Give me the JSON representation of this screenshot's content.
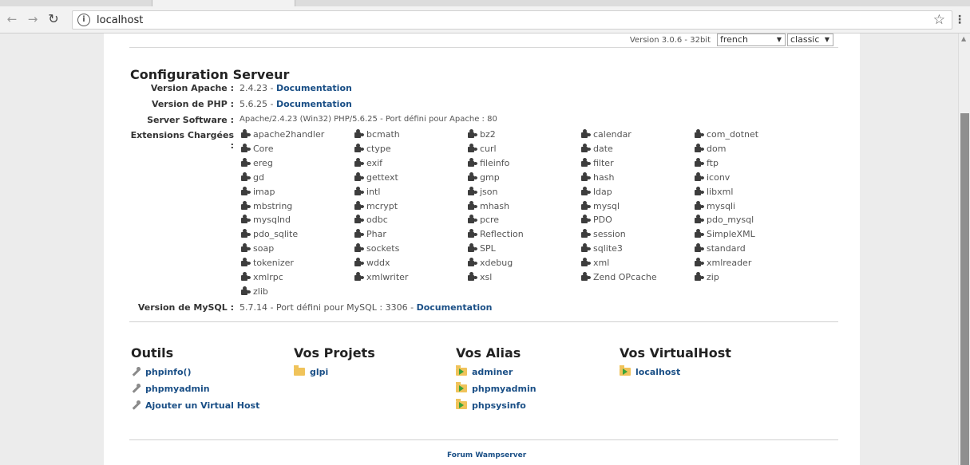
{
  "browser": {
    "url": "localhost",
    "back_icon": "back-arrow-icon",
    "forward_icon": "forward-arrow-icon",
    "reload_icon": "reload-icon"
  },
  "top": {
    "version": "Version 3.0.6 - 32bit",
    "language": "french",
    "style": "classic"
  },
  "config": {
    "title": "Configuration Serveur",
    "apache_label": "Version Apache :",
    "apache_value": "2.4.23 -",
    "apache_doc": "Documentation",
    "php_label": "Version de PHP :",
    "php_value": "5.6.25 -",
    "php_doc": "Documentation",
    "software_label": "Server Software :",
    "software_value": "Apache/2.4.23 (Win32) PHP/5.6.25 - Port défini pour Apache : 80",
    "extensions_label": "Extensions Chargées :",
    "extensions": [
      "apache2handler",
      "bcmath",
      "bz2",
      "calendar",
      "com_dotnet",
      "Core",
      "ctype",
      "curl",
      "date",
      "dom",
      "ereg",
      "exif",
      "fileinfo",
      "filter",
      "ftp",
      "gd",
      "gettext",
      "gmp",
      "hash",
      "iconv",
      "imap",
      "intl",
      "json",
      "ldap",
      "libxml",
      "mbstring",
      "mcrypt",
      "mhash",
      "mysql",
      "mysqli",
      "mysqlnd",
      "odbc",
      "pcre",
      "PDO",
      "pdo_mysql",
      "pdo_sqlite",
      "Phar",
      "Reflection",
      "session",
      "SimpleXML",
      "soap",
      "sockets",
      "SPL",
      "sqlite3",
      "standard",
      "tokenizer",
      "wddx",
      "xdebug",
      "xml",
      "xmlreader",
      "xmlrpc",
      "xmlwriter",
      "xsl",
      "Zend OPcache",
      "zip",
      "zlib"
    ],
    "mysql_label": "Version de MySQL :",
    "mysql_value": "5.7.14 - Port défini pour MySQL : 3306 -",
    "mysql_doc": "Documentation"
  },
  "sections": {
    "outils": {
      "title": "Outils",
      "items": [
        "phpinfo()",
        "phpmyadmin",
        "Ajouter un Virtual Host"
      ]
    },
    "projets": {
      "title": "Vos Projets",
      "items": [
        "glpi"
      ]
    },
    "alias": {
      "title": "Vos Alias",
      "items": [
        "adminer",
        "phpmyadmin",
        "phpsysinfo"
      ]
    },
    "virtualhost": {
      "title": "Vos VirtualHost",
      "items": [
        "localhost"
      ]
    }
  },
  "footer": {
    "link": "Forum Wampserver"
  }
}
